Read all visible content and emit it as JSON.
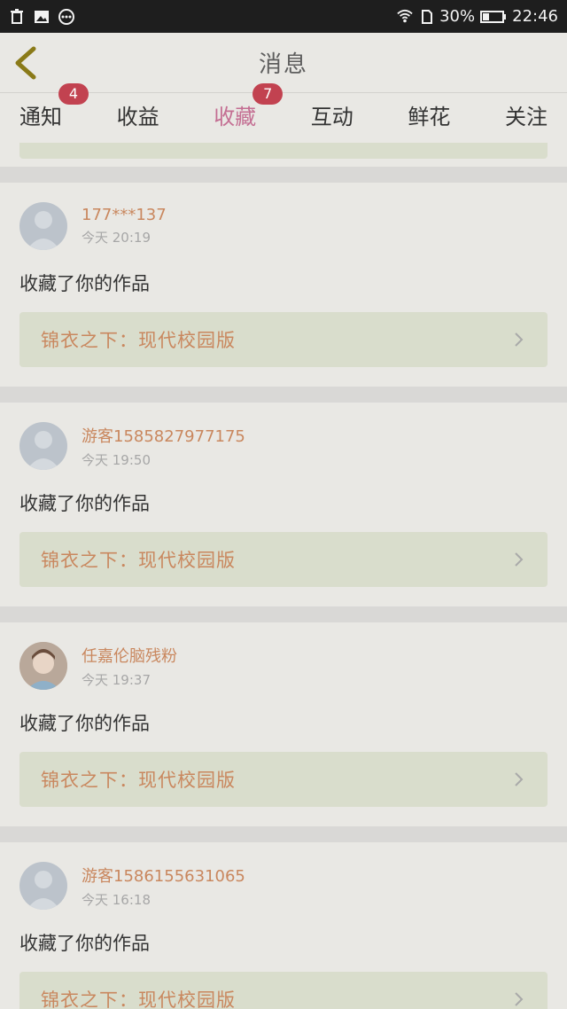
{
  "status_bar": {
    "icons_left": [
      "trash-icon",
      "image-icon",
      "more-circle-icon"
    ],
    "battery": "30%",
    "time": "22:46"
  },
  "header": {
    "title": "消息"
  },
  "tabs": [
    {
      "label": "通知",
      "badge": "4"
    },
    {
      "label": "收益",
      "badge": ""
    },
    {
      "label": "收藏",
      "badge": "7",
      "active": true
    },
    {
      "label": "互动",
      "badge": ""
    },
    {
      "label": "鲜花",
      "badge": ""
    },
    {
      "label": "关注",
      "badge": ""
    }
  ],
  "items": [
    {
      "user": "177***137",
      "time": "今天 20:19",
      "action": "收藏了你的作品",
      "work": "锦衣之下：现代校园版"
    },
    {
      "user": "游客1585827977175",
      "time": "今天 19:50",
      "action": "收藏了你的作品",
      "work": "锦衣之下：现代校园版"
    },
    {
      "user": "任嘉伦脑残粉",
      "time": "今天 19:37",
      "action": "收藏了你的作品",
      "work": "锦衣之下：现代校园版"
    },
    {
      "user": "游客1586155631065",
      "time": "今天 16:18",
      "action": "收藏了你的作品",
      "work": "锦衣之下：现代校园版"
    }
  ]
}
